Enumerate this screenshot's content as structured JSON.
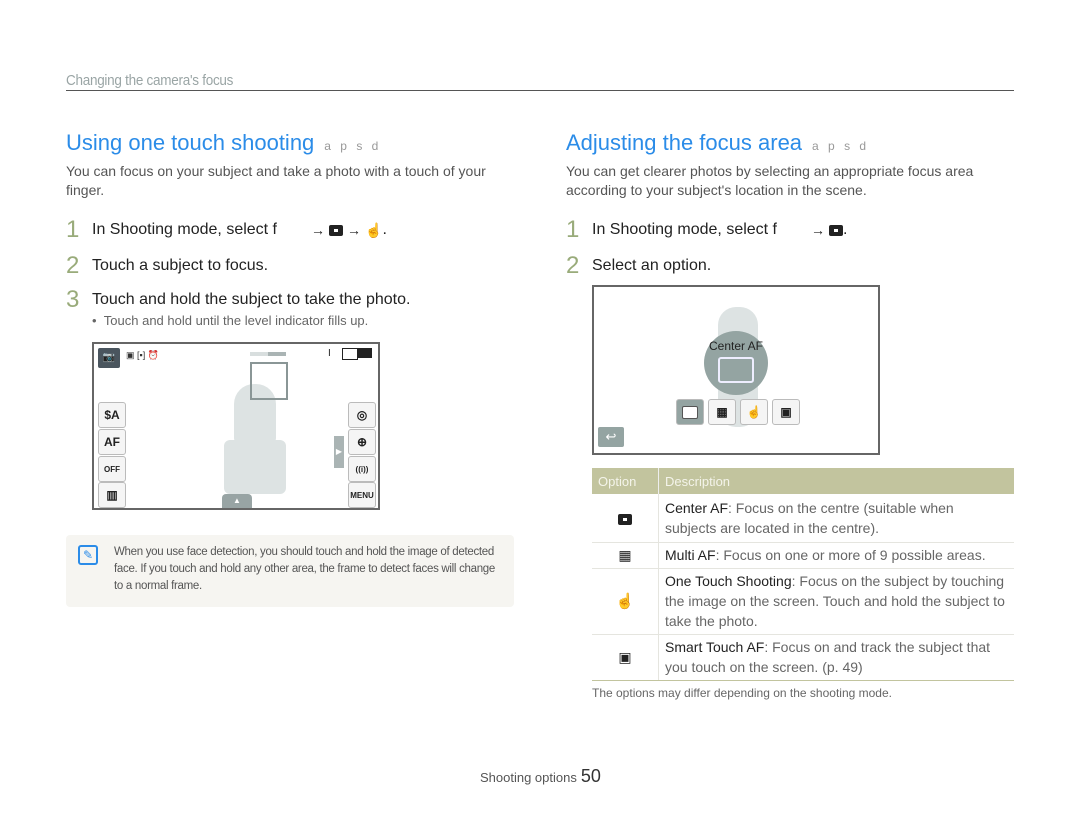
{
  "header": {
    "section": "Changing the camera's focus"
  },
  "left": {
    "title": "Using one touch shooting",
    "modes": "a p s d",
    "intro": "You can focus on your subject and take a photo with a touch of your finger.",
    "steps": [
      {
        "num": "1",
        "text": "In Shooting mode, select f",
        "tail": "."
      },
      {
        "num": "2",
        "text": "Touch a subject to focus."
      },
      {
        "num": "3",
        "text": "Touch and hold the subject to take the photo."
      }
    ],
    "bullet": "Touch and hold until the level indicator fills up.",
    "screen": {
      "left_buttons": [
        "$A",
        "AF",
        "OFF",
        "▥"
      ],
      "right_buttons": [
        "◎",
        "⊕",
        "((i))",
        "MENU"
      ],
      "top_right": "I"
    },
    "note": "When you use face detection, you should touch and hold the image of detected face. If you touch and hold any other area, the frame to detect faces will change to a normal frame."
  },
  "right": {
    "title": "Adjusting the focus area",
    "modes": "a p s d",
    "intro": "You can get clearer photos by selecting an appropriate focus area according to your subject's location in the scene.",
    "steps": [
      {
        "num": "1",
        "text": "In Shooting mode, select f",
        "tail": "."
      },
      {
        "num": "2",
        "text": "Select an option."
      }
    ],
    "screen": {
      "label": "Center AF"
    },
    "table": {
      "headers": [
        "Option",
        "Description"
      ],
      "rows": [
        {
          "name": "Center AF",
          "desc": ": Focus on the centre (suitable when subjects are located in the centre)."
        },
        {
          "name": "Multi AF",
          "desc": ": Focus on one or more of 9 possible areas."
        },
        {
          "name": "One Touch Shooting",
          "desc": ": Focus on the subject by touching the image on the screen. Touch and hold the subject to take the photo."
        },
        {
          "name": "Smart Touch AF",
          "desc": ": Focus on and track the subject that you touch on the screen. (p. 49)"
        }
      ]
    },
    "footnote": "The options may differ depending on the shooting mode."
  },
  "footer": {
    "label": "Shooting options",
    "page": "50"
  },
  "colors": {
    "accent": "#2b8ce8",
    "step_number": "#99ab7a",
    "table_header": "#c2c49e"
  }
}
